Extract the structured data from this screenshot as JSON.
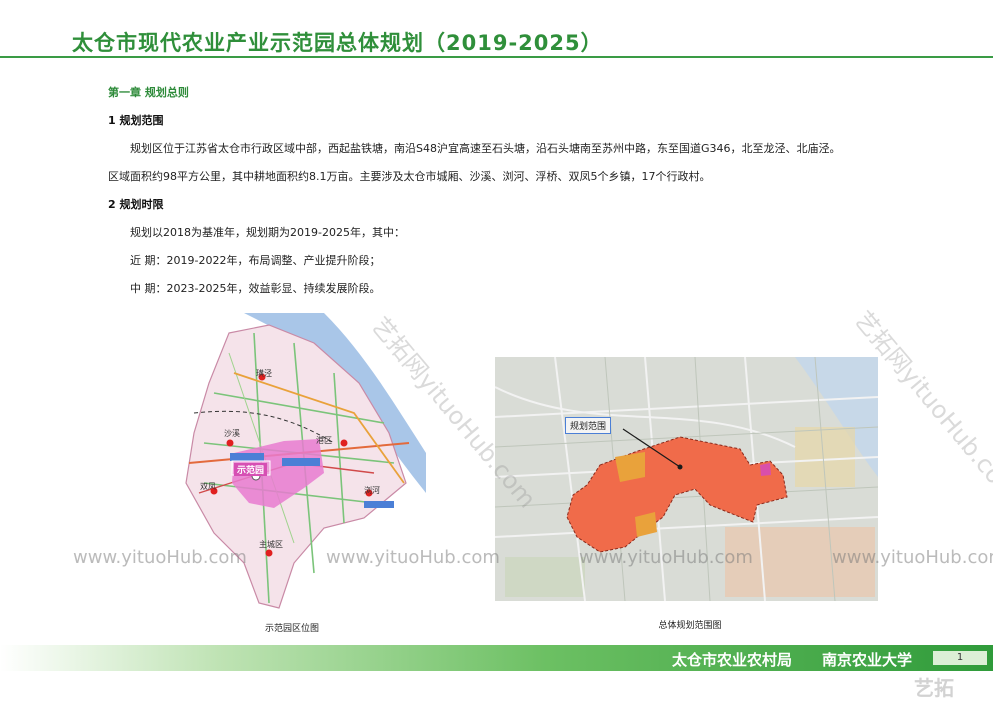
{
  "header": {
    "title": "太仓市现代农业产业示范园总体规划（2019-2025）"
  },
  "chapter": {
    "title": "第一章  规划总则"
  },
  "section1": {
    "heading": "1  规划范围",
    "p1": "规划区位于江苏省太仓市行政区域中部，西起盐铁塘，南沿S48沪宜高速至石头塘，沿石头塘南至苏州中路，东至国道G346，北至龙泾、北庙泾。",
    "p2": "区域面积约98平方公里，其中耕地面积约8.1万亩。主要涉及太仓市城厢、沙溪、浏河、浮桥、双凤5个乡镇，17个行政村。"
  },
  "section2": {
    "heading": "2  规划时限",
    "p1": "规划以2018为基准年，规划期为2019-2025年，其中：",
    "p2": "近   期：2019-2022年，布局调整、产业提升阶段；",
    "p3": "中   期：2023-2025年，效益彰显、持续发展阶段。"
  },
  "map_left": {
    "caption": "示范园区位图",
    "labels": {
      "lz": "璜泾",
      "sx": "沙溪",
      "gq": "港区",
      "sf": "双凤",
      "lh": "浏河",
      "cx": "主城区",
      "park": "示范园"
    }
  },
  "map_right": {
    "caption": "总体规划范围图",
    "label": "规划范围"
  },
  "watermarks": {
    "url": "www.yituoHub.com",
    "diag": "艺拓网yituoHub.com",
    "corner": "艺拓"
  },
  "footer": {
    "org1": "太仓市农业农村局",
    "org2": "南京农业大学",
    "page": "1"
  }
}
